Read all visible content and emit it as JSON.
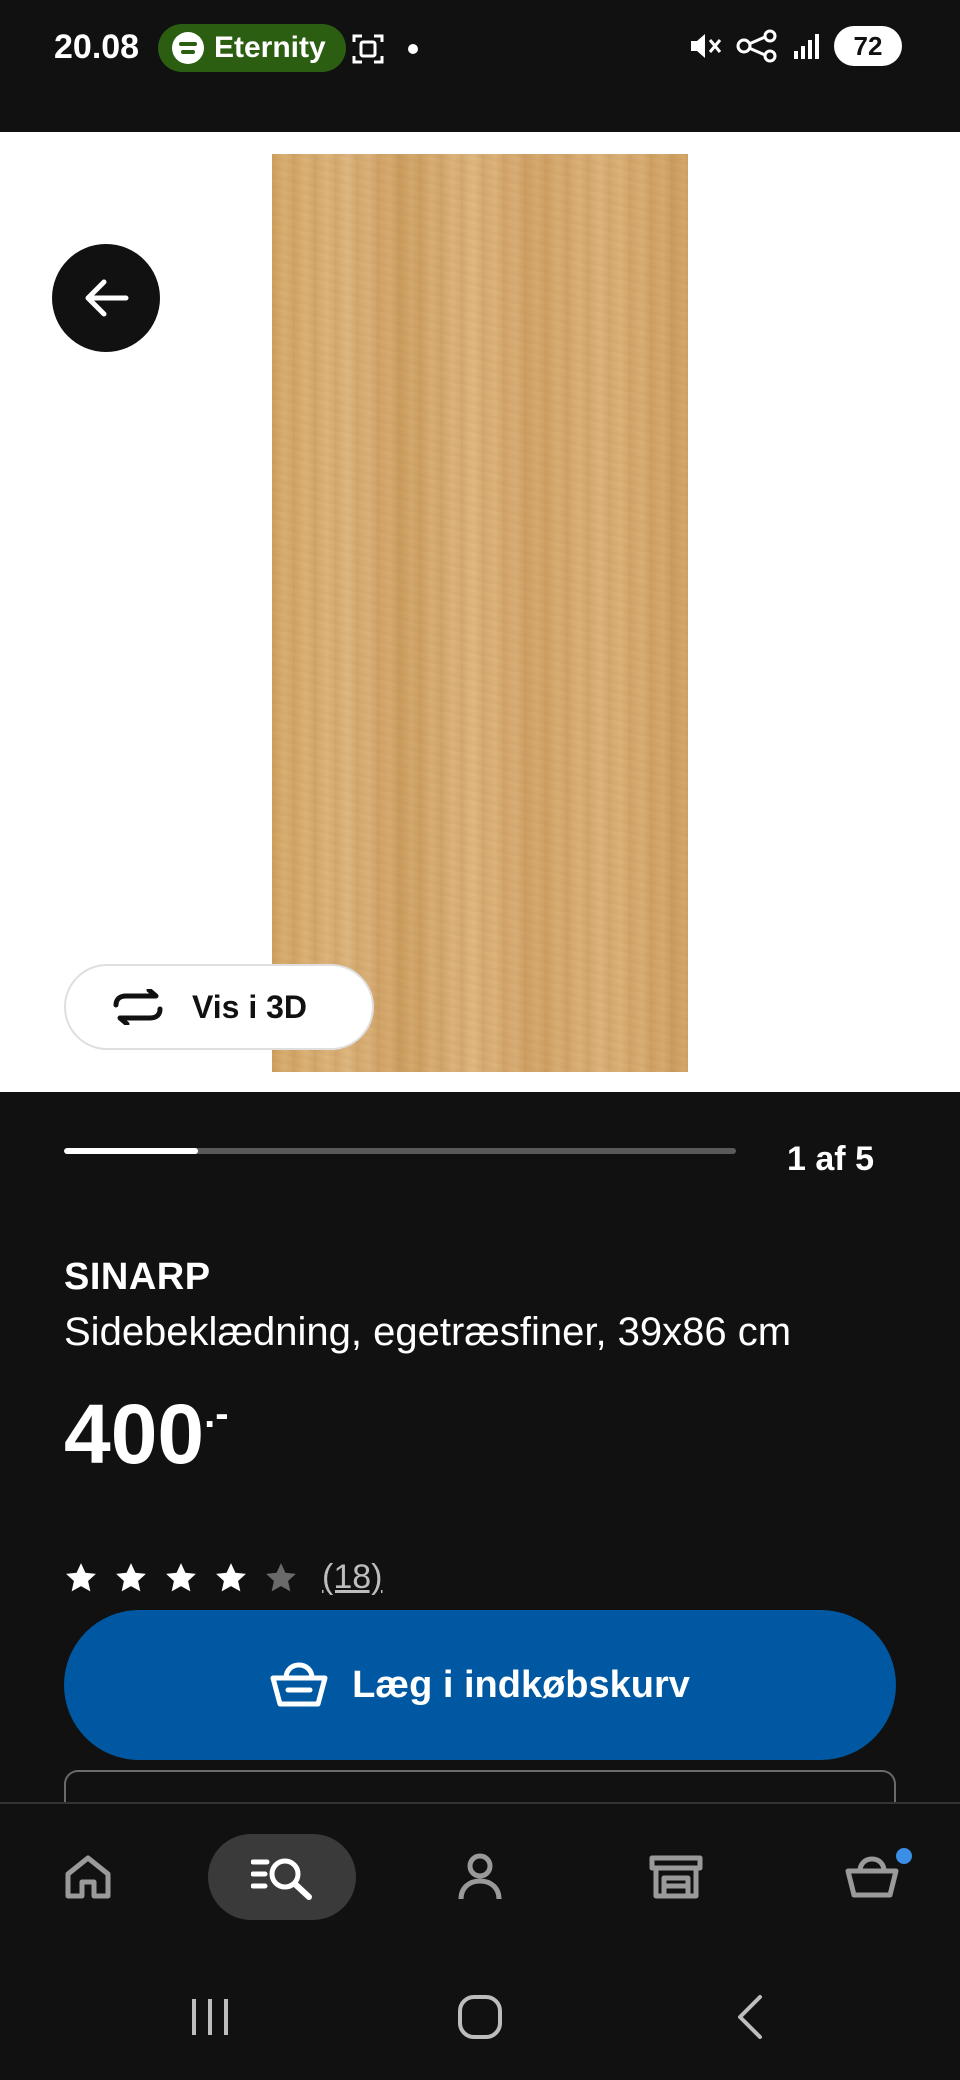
{
  "status_bar": {
    "time": "20.08",
    "media_app_label": "Eternity",
    "battery": "72"
  },
  "hero": {
    "view_3d_label": "Vis i 3D"
  },
  "carousel": {
    "counter": "1 af 5",
    "progress": 0.2
  },
  "product": {
    "name": "SINARP",
    "description": "Sidebeklædning, egetræsfiner, 39x86 cm",
    "price": "400",
    "price_suffix": ".-",
    "rating": 4,
    "rating_max": 5,
    "rating_count": "(18)"
  },
  "actions": {
    "add_to_cart_label": "Læg i indkøbskurv"
  },
  "bottom_nav": {
    "items": [
      "home",
      "search",
      "profile",
      "stores",
      "cart"
    ],
    "active": "search"
  },
  "colors": {
    "accent_blue": "#0058a3",
    "background": "#111111",
    "badge_blue": "#3a8ee6"
  }
}
